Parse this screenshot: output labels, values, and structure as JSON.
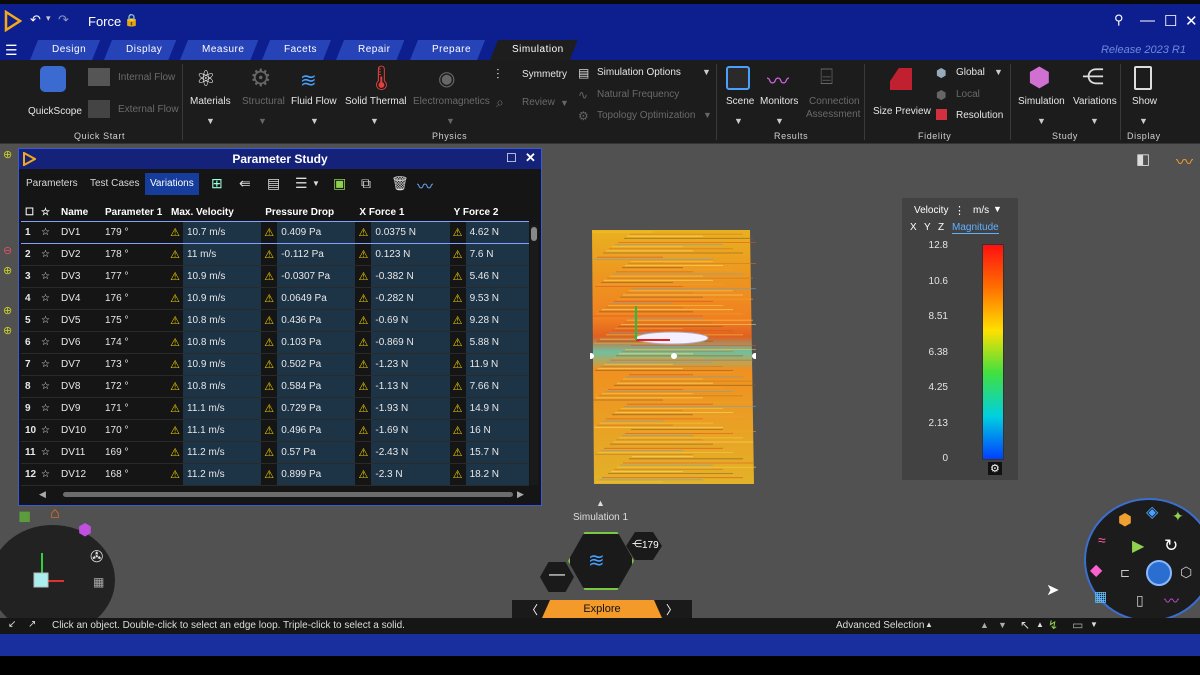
{
  "title_bar": {
    "doc_title": "Force",
    "lock_icon": "lock-warning-icon",
    "controls": [
      "pin-icon",
      "minimize-icon",
      "maximize-icon",
      "close-icon"
    ]
  },
  "tabs": [
    "Design",
    "Display",
    "Measure",
    "Facets",
    "Repair",
    "Prepare",
    "Simulation"
  ],
  "active_tab": "Simulation",
  "release": "Release 2023 R1",
  "ribbon": {
    "quickscope": "QuickScope",
    "internal_flow": "Internal Flow",
    "external_flow": "External Flow",
    "materials": "Materials",
    "structural": "Structural",
    "fluid_flow": "Fluid Flow",
    "solid_thermal": "Solid Thermal",
    "electromagnetics": "Electromagnetics",
    "symmetry": "Symmetry",
    "review": "Review",
    "simulation_options": "Simulation Options",
    "natural_frequency": "Natural Frequency",
    "topology_optimization": "Topology Optimization",
    "scene": "Scene",
    "monitors": "Monitors",
    "connection": "Connection",
    "assessment": "Assessment",
    "size_preview": "Size Preview",
    "global": "Global",
    "local": "Local",
    "resolution": "Resolution",
    "simulation": "Simulation",
    "variations": "Variations",
    "show": "Show",
    "groups": {
      "quick_start": "Quick Start",
      "physics": "Physics",
      "results": "Results",
      "fidelity": "Fidelity",
      "study": "Study",
      "display": "Display"
    }
  },
  "panel": {
    "title": "Parameter Study",
    "tabs": [
      "Parameters",
      "Test Cases",
      "Variations"
    ],
    "active_tab": "Variations",
    "columns": [
      "Name",
      "Parameter 1",
      "Max. Velocity",
      "Pressure Drop",
      "X Force 1",
      "Y Force 2"
    ],
    "rows": [
      {
        "n": "1",
        "name": "DV1",
        "p": "179 °",
        "mv": "10.7 m/s",
        "pd": "0.409 Pa",
        "xf": "0.0375 N",
        "yf": "4.62 N"
      },
      {
        "n": "2",
        "name": "DV2",
        "p": "178 °",
        "mv": "11 m/s",
        "pd": "-0.112 Pa",
        "xf": "0.123 N",
        "yf": "7.6 N"
      },
      {
        "n": "3",
        "name": "DV3",
        "p": "177 °",
        "mv": "10.9 m/s",
        "pd": "-0.0307 Pa",
        "xf": "-0.382 N",
        "yf": "5.46 N"
      },
      {
        "n": "4",
        "name": "DV4",
        "p": "176 °",
        "mv": "10.9 m/s",
        "pd": "0.0649 Pa",
        "xf": "-0.282 N",
        "yf": "9.53 N"
      },
      {
        "n": "5",
        "name": "DV5",
        "p": "175 °",
        "mv": "10.8 m/s",
        "pd": "0.436 Pa",
        "xf": "-0.69 N",
        "yf": "9.28 N"
      },
      {
        "n": "6",
        "name": "DV6",
        "p": "174 °",
        "mv": "10.8 m/s",
        "pd": "0.103 Pa",
        "xf": "-0.869 N",
        "yf": "5.88 N"
      },
      {
        "n": "7",
        "name": "DV7",
        "p": "173 °",
        "mv": "10.9 m/s",
        "pd": "0.502 Pa",
        "xf": "-1.23 N",
        "yf": "11.9 N"
      },
      {
        "n": "8",
        "name": "DV8",
        "p": "172 °",
        "mv": "10.8 m/s",
        "pd": "0.584 Pa",
        "xf": "-1.13 N",
        "yf": "7.66 N"
      },
      {
        "n": "9",
        "name": "DV9",
        "p": "171 °",
        "mv": "11.1 m/s",
        "pd": "0.729 Pa",
        "xf": "-1.93 N",
        "yf": "14.9 N"
      },
      {
        "n": "10",
        "name": "DV10",
        "p": "170 °",
        "mv": "11.1 m/s",
        "pd": "0.496 Pa",
        "xf": "-1.69 N",
        "yf": "16 N"
      },
      {
        "n": "11",
        "name": "DV11",
        "p": "169 °",
        "mv": "11.2 m/s",
        "pd": "0.57 Pa",
        "xf": "-2.43 N",
        "yf": "15.7 N"
      },
      {
        "n": "12",
        "name": "DV12",
        "p": "168 °",
        "mv": "11.2 m/s",
        "pd": "0.899 Pa",
        "xf": "-2.3 N",
        "yf": "18.2 N"
      }
    ]
  },
  "legend": {
    "label": "Velocity",
    "unit": "m/s",
    "axes": [
      "X",
      "Y",
      "Z"
    ],
    "mode": "Magnitude",
    "ticks": [
      "12.8",
      "10.6",
      "8.51",
      "6.38",
      "4.25",
      "2.13",
      "0"
    ]
  },
  "hud": {
    "simulation_label": "Simulation 1",
    "badge": "179",
    "explore": "Explore"
  },
  "status": {
    "hint": "Click an object. Double-click to select an edge loop. Triple-click to select a solid.",
    "advanced": "Advanced Selection"
  }
}
